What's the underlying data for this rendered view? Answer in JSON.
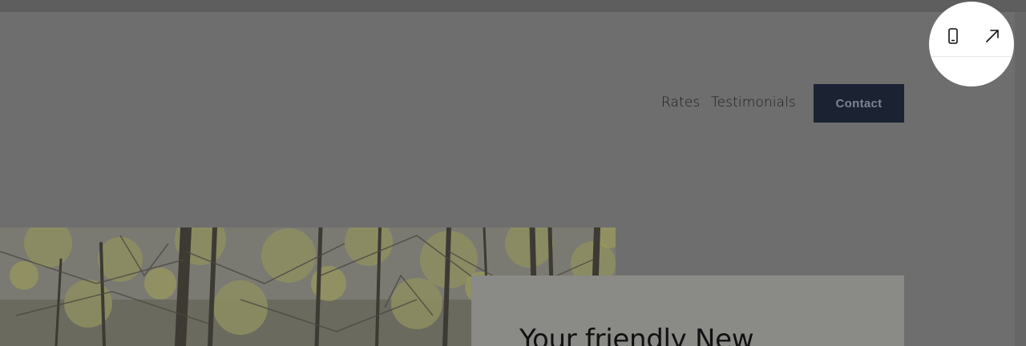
{
  "nav": {
    "links": [
      "Rates",
      "Testimonials"
    ],
    "contact_label": "Contact"
  },
  "hero": {
    "heading": "Your friendly New"
  },
  "toolbar": {
    "icons": [
      "mobile-icon",
      "external-link-arrow-icon"
    ]
  },
  "colors": {
    "overlay_background": "#6e6e6e",
    "contact_button": "#1b2232",
    "text_card": "#8a8a87",
    "badge": "#ffffff"
  }
}
